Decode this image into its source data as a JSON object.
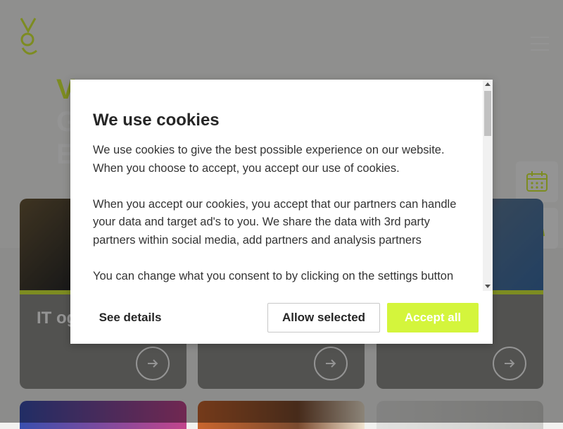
{
  "header": {
    "logo_icon": "stylized-logo-icon",
    "menu_icon": "hamburger-menu-icon"
  },
  "hero": {
    "title_lines": [
      "V",
      "G",
      "E"
    ]
  },
  "side_buttons": [
    {
      "icon": "calendar-icon"
    },
    {
      "icon": "document-icon"
    }
  ],
  "cards": [
    {
      "title": "IT og",
      "arrow_icon": "arrow-right-icon"
    },
    {
      "title": "",
      "arrow_icon": "arrow-right-icon"
    },
    {
      "title": "",
      "arrow_icon": "arrow-right-icon"
    }
  ],
  "cookie_modal": {
    "heading": "We use cookies",
    "paragraph1": "We use cookies to give the best possible experience on our website. When you choose to accept, you accept our use of cookies.",
    "paragraph2": "When you accept our cookies, you accept that our partners can handle your data and target ad's to you. We share the data with 3rd party partners within social media, add partners and analysis partners",
    "paragraph3": "You can change what you consent to by clicking on the settings button",
    "see_details_label": "See details",
    "allow_selected_label": "Allow selected",
    "accept_all_label": "Accept all"
  },
  "colors": {
    "accent": "#d4f53c",
    "modal_bg": "#ffffff",
    "overlay": "rgba(0,0,0,0.42)"
  }
}
